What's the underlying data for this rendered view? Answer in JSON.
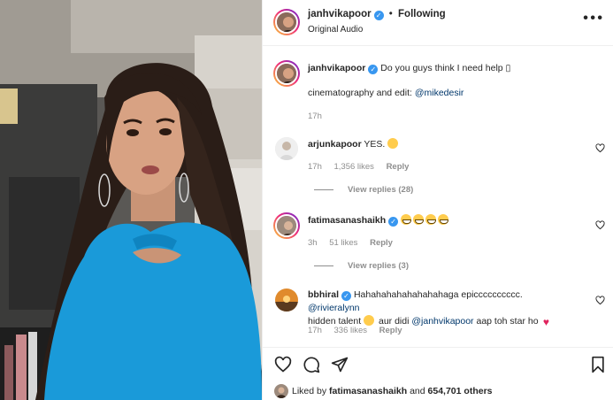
{
  "post": {
    "author": "janhvikapoor",
    "separator": "•",
    "follow_status": "Following",
    "audio": "Original Audio",
    "more_icon": "more-horizontal-icon"
  },
  "caption": {
    "user": "janhvikapoor",
    "text": "Do you guys think I need help",
    "text_glyph": "▯",
    "line2_prefix": "cinematography and edit:",
    "line2_mention": "@mikedesir",
    "time": "17h"
  },
  "comments": [
    {
      "user": "arjunkapoor",
      "verified": false,
      "text": "YES.",
      "emojis": [
        "face-with-open-mouth"
      ],
      "time": "17h",
      "likes": "1,356 likes",
      "reply": "Reply",
      "view_replies": "View replies (28)"
    },
    {
      "user": "fatimasanashaikh",
      "verified": true,
      "text": "",
      "emojis": [
        "grinning-face",
        "grinning-face",
        "grinning-face",
        "grinning-face"
      ],
      "time": "3h",
      "likes": "51 likes",
      "reply": "Reply",
      "view_replies": "View replies (3)"
    },
    {
      "user": "bbhiral",
      "verified": true,
      "text_a": "Hahahahahahahahahaga epicccccccccc.",
      "mention_a": "@rivieralynn",
      "text_b": "hidden talent",
      "text_c": "aur didi",
      "mention_b": "@janhvikapoor",
      "text_d": "aap toh star ho",
      "time": "17h",
      "likes": "336 likes",
      "reply": "Reply"
    }
  ],
  "footer": {
    "liked_prefix": "Liked by",
    "liked_user": "fatimasanashaikh",
    "liked_and": "and",
    "liked_count": "654,701 others"
  },
  "colors": {
    "verified": "#3897f0",
    "link": "#00376b",
    "muted": "#8e8e8e",
    "heart_red": "#e0245e",
    "dress_blue": "#1a9ad9"
  }
}
